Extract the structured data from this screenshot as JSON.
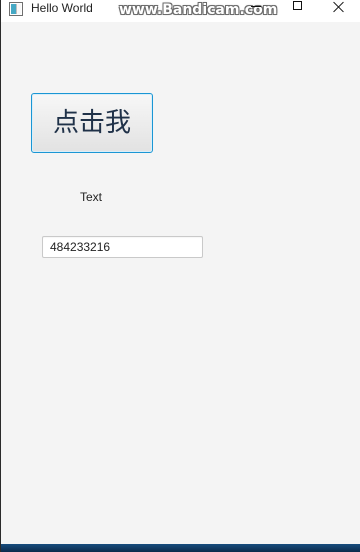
{
  "window": {
    "title": "Hello World"
  },
  "watermark": {
    "text": "www.Bandicam.com"
  },
  "main": {
    "button_label": "点击我",
    "label_text": "Text",
    "input_value": "484233216"
  },
  "icons": {
    "app": "app-icon",
    "minimize": "minimize-icon",
    "maximize": "maximize-icon",
    "close": "close-icon"
  },
  "colors": {
    "button_border": "#1a96d4",
    "button_text": "#1f3148",
    "window_background": "#f4f4f4",
    "taskbar": "#174d7e"
  }
}
